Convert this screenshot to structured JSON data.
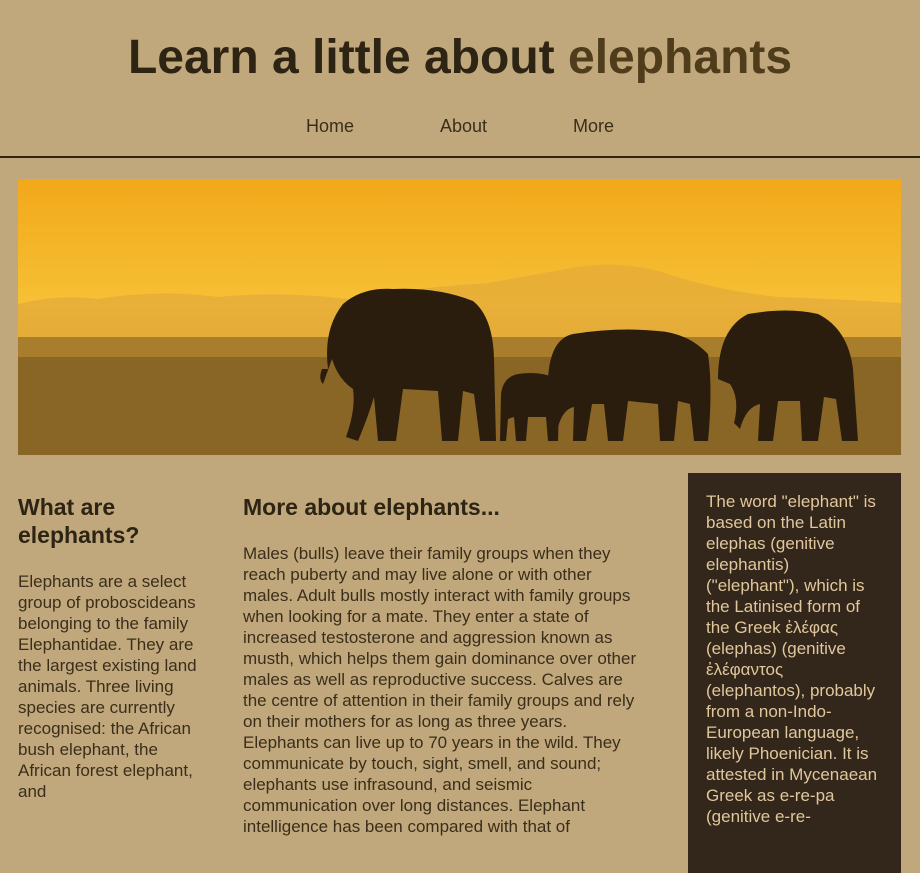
{
  "header": {
    "title_main": "Learn a little about ",
    "title_accent": "elephants"
  },
  "nav": {
    "items": [
      {
        "label": "Home"
      },
      {
        "label": "About"
      },
      {
        "label": "More"
      }
    ]
  },
  "banner": {
    "image": "elephants-silhouette-sunset"
  },
  "section1": {
    "heading": "What are elephants?",
    "body": "Elephants are a select group of proboscideans belonging to the family Elephantidae. They are the largest existing land animals. Three living species are currently recognised: the African bush elephant, the African forest elephant, and"
  },
  "section2": {
    "heading": "More about elephants...",
    "body": "Males (bulls) leave their family groups when they reach puberty and may live alone or with other males. Adult bulls mostly interact with family groups when looking for a mate. They enter a state of increased testosterone and aggression known as musth, which helps them gain dominance over other males as well as reproductive success. Calves are the centre of attention in their family groups and rely on their mothers for as long as three years. Elephants can live up to 70 years in the wild. They communicate by touch, sight, smell, and sound; elephants use infrasound, and seismic communication over long distances. Elephant intelligence has been compared with that of"
  },
  "aside": {
    "body": "The word \"elephant\" is based on the Latin elephas (genitive elephantis) (\"elephant\"), which is the Latinised form of the Greek ἐλέφας (elephas) (genitive ἐλέφαντος (elephantos), probably from a non-Indo-European language, likely Phoenician. It is attested in Mycenaean Greek as e-re-pa (genitive e-re-"
  },
  "colors": {
    "background": "#c0a87c",
    "aside_bg": "#33261a",
    "aside_text": "#e0c79c",
    "title": "#2d2414"
  }
}
